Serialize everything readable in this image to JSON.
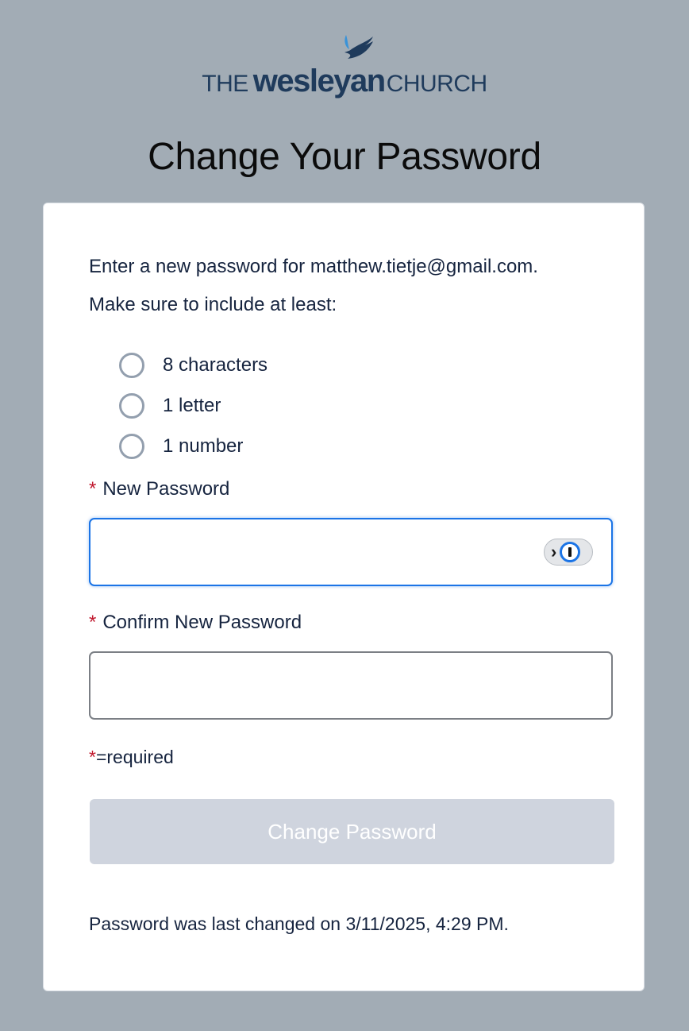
{
  "logo": {
    "the": "THE",
    "main": "wesleyan",
    "church": "CHURCH",
    "colors": {
      "flame_dark": "#1f3b5c",
      "flame_light": "#3a93d8"
    }
  },
  "page_title": "Change Your Password",
  "card": {
    "intro_prefix": "Enter a new password for ",
    "email": "matthew.tietje@gmail.com",
    "intro_suffix": ".",
    "requirements_heading": "Make sure to include at least:",
    "requirements": [
      {
        "label": "8 characters"
      },
      {
        "label": "1 letter"
      },
      {
        "label": "1 number"
      }
    ],
    "new_password": {
      "required_mark": "*",
      "label": "New Password",
      "value": ""
    },
    "confirm_password": {
      "required_mark": "*",
      "label": "Confirm New Password",
      "value": ""
    },
    "password_manager_icon": "password-manager-key-icon",
    "required_note_mark": "*",
    "required_note_text": "=required",
    "submit_label": "Change Password",
    "last_changed": "Password was last changed on 3/11/2025, 4:29 PM."
  },
  "colors": {
    "background": "#a2acb5",
    "accent_blue": "#1b74e6",
    "required_red": "#c0172d",
    "disabled_button": "#cfd4de"
  }
}
